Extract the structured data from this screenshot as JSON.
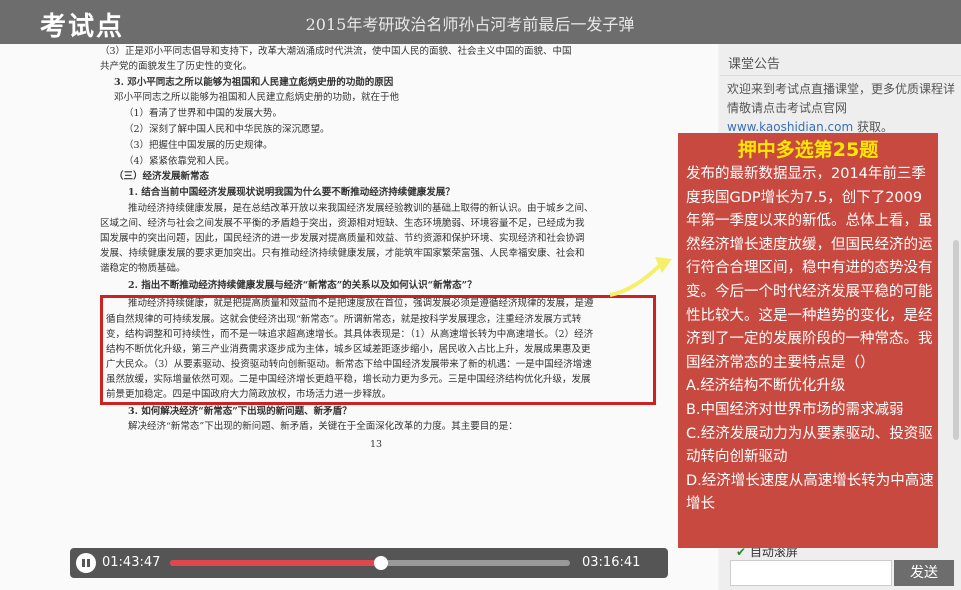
{
  "header": {
    "logo": "考试点",
    "title": "2015年考研政治名师孙占河考前最后一发子弹"
  },
  "document": {
    "lines": [
      "（3）正是邓小平同志倡导和支持下，改革大潮汹涌成时代洪流，使中国人民的面貌、社会主义中国的面貌、中国",
      "共产党的面貌发生了历史性的变化。",
      "3. 邓小平同志之所以能够为祖国和人民建立彪炳史册的功勋的原因",
      "邓小平同志之所以能够为祖国和人民建立彪炳史册的功勋，就在于他",
      "（1）看清了世界和中国的发展大势。",
      "（2）深刻了解中国人民和中华民族的深沉愿望。",
      "（3）把握住中国发展的历史规律。",
      "（4）紧紧依靠党和人民。",
      "（三）经济发展新常态",
      "1. 结合当前中国经济发展现状说明我国为什么要不断推动经济持续健康发展？",
      "推动经济持续健康发展，是在总结改革开放以来我国经济发展经验教训的基础上取得的新认识。由于城乡之间、",
      "区域之间、经济与社会之间发展不平衡的矛盾趋于突出，资源相对短缺、生态环境脆弱、环境容量不足，已经成为我",
      "国发展中的突出问题，因此，国民经济的进一步发展对提高质量和效益、节约资源和保护环境、实现经济和社会协调",
      "发展、持续健康发展的要求更加突出。只有推动经济持续健康发展，才能筑牢国家繁荣富强、人民幸福安康、社会和",
      "谐稳定的物质基础。",
      "2. 指出不断推动经济持续健康发展与经济“新常态”的关系以及如何认识“新常态”？",
      "推动经济持续健康，就是把提高质量和效益而不是把速度放在首位，强调发展必须是遵循经济规律的发展，是遵",
      "循自然规律的可持续发展。这就会使经济出现“新常态”。所谓新常态，就是按科学发展理念，注重经济发展方式转",
      "变，结构调整和可持续性，而不是一味追求超高速增长。其具体表现是：（1）从高速增长转为中高速增长。（2）经济",
      "结构不断优化升级，第三产业消费需求逐步成为主体，城乡区域差距逐步缩小，居民收入占比上升，发展成果惠及更",
      "广大民众。（3）从要素驱动、投资驱动转向创新驱动。新常态下给中国经济发展带来了新的机遇：一是中国经济增速",
      "虽然放缓，实际增量依然可观。二是中国经济增长更趋平稳，增长动力更为多元。三是中国经济结构优化升级，发展",
      "前景更加稳定。四是中国政府大力简政放权，市场活力进一步释放。",
      "3. 如何解决经济“新常态”下出现的新问题、新矛盾？",
      "解决经济“新常态”下出现的新问题、新矛盾，关键在于全面深化改革的力度。其主要目的是：",
      "13"
    ]
  },
  "player": {
    "current_time": "01:43:47",
    "total_time": "03:16:41",
    "progress": 0.528
  },
  "sidebar": {
    "notice_title": "课堂公告",
    "notice_text": "欢迎来到考试点直播课堂，更多优质课程详情敬请点击考试点官网",
    "notice_link": "www.kaoshidian.com",
    "notice_suffix": " 获取。",
    "auto_scroll_label": "自动滚屏",
    "send_label": "发送"
  },
  "popup": {
    "title": "押中多选第25题",
    "question": "发布的最新数据显示，2014年前三季度我国GDP增长为7.5，创下了2009年第一季度以来的新低。总体上看，虽然经济增长速度放缓，但国民经济的运行符合合理区间，稳中有进的态势没有变。今后一个时代经济发展平稳的可能性比较大。这是一种趋势的变化，是经济到了一定的发展阶段的一种常态。我国经济常态的主要特点是（）",
    "options": [
      "A.经济结构不断优化升级",
      "B.中国经济对世界市场的需求减弱",
      "C.经济发展动力为从要素驱动、投资驱动转向创新驱动",
      "D.经济增长速度从高速增长转为中高速增长"
    ]
  },
  "colors": {
    "popup_bg": "#c7493f",
    "popup_title": "#ffe600",
    "progress_fill": "#e0474c",
    "highlight_box": "#cc2222"
  }
}
